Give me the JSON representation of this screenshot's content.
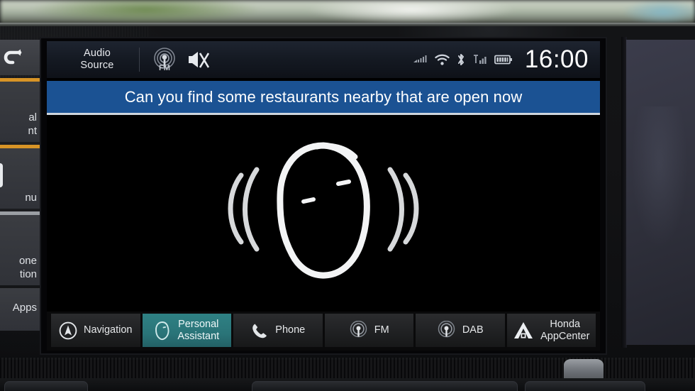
{
  "device": {
    "name": "honda-infotainment-head-unit"
  },
  "sidebar": {
    "back_icon": "back-arrow-icon",
    "items": [
      {
        "label": "al\nnt",
        "full": "Personal Assistant",
        "accent": "#d89426",
        "icon": ""
      },
      {
        "label": "nu",
        "full": "Menu",
        "accent": "#d89426",
        "icon": "menu-tile-icon"
      },
      {
        "label": "one\ntion",
        "full": "Phone Connection",
        "accent": "#9a9ea3",
        "icon": ""
      },
      {
        "label": "Apps",
        "full": "Apps",
        "accent": "",
        "icon": ""
      }
    ]
  },
  "statusbar": {
    "audio_source_line1": "Audio",
    "audio_source_line2": "Source",
    "fm_icon_label": "FM",
    "mute_icon": "speaker-mute-icon",
    "icons": [
      "cellular-roam-icon",
      "wifi-icon",
      "bluetooth-icon",
      "signal-bars-icon",
      "battery-icon"
    ],
    "clock": "16:00"
  },
  "banner": {
    "text": "Can you find some restaurants nearby that are open now",
    "background": "#1b5293"
  },
  "voice": {
    "graphic": "speaking-head-icon",
    "left_waves": "sound-wave-left-icon",
    "right_waves": "sound-wave-right-icon"
  },
  "tabs": [
    {
      "label": "Navigation",
      "icon": "compass-icon",
      "active": false,
      "lines": 1
    },
    {
      "label_line1": "Personal",
      "label_line2": "Assistant",
      "icon": "head-outline-icon",
      "active": true,
      "lines": 2
    },
    {
      "label": "Phone",
      "icon": "phone-handset-icon",
      "active": false,
      "lines": 1
    },
    {
      "label": "FM",
      "icon": "radio-antenna-icon",
      "active": false,
      "lines": 1
    },
    {
      "label": "DAB",
      "icon": "radio-antenna-icon",
      "active": false,
      "lines": 1
    },
    {
      "label_line1": "Honda",
      "label_line2": "AppCenter",
      "icon": "honda-a-logo-icon",
      "active": false,
      "lines": 2
    }
  ],
  "colors": {
    "accent_teal": "#2a7478",
    "banner_blue": "#1b5293",
    "sidebar_accent": "#d89426"
  }
}
